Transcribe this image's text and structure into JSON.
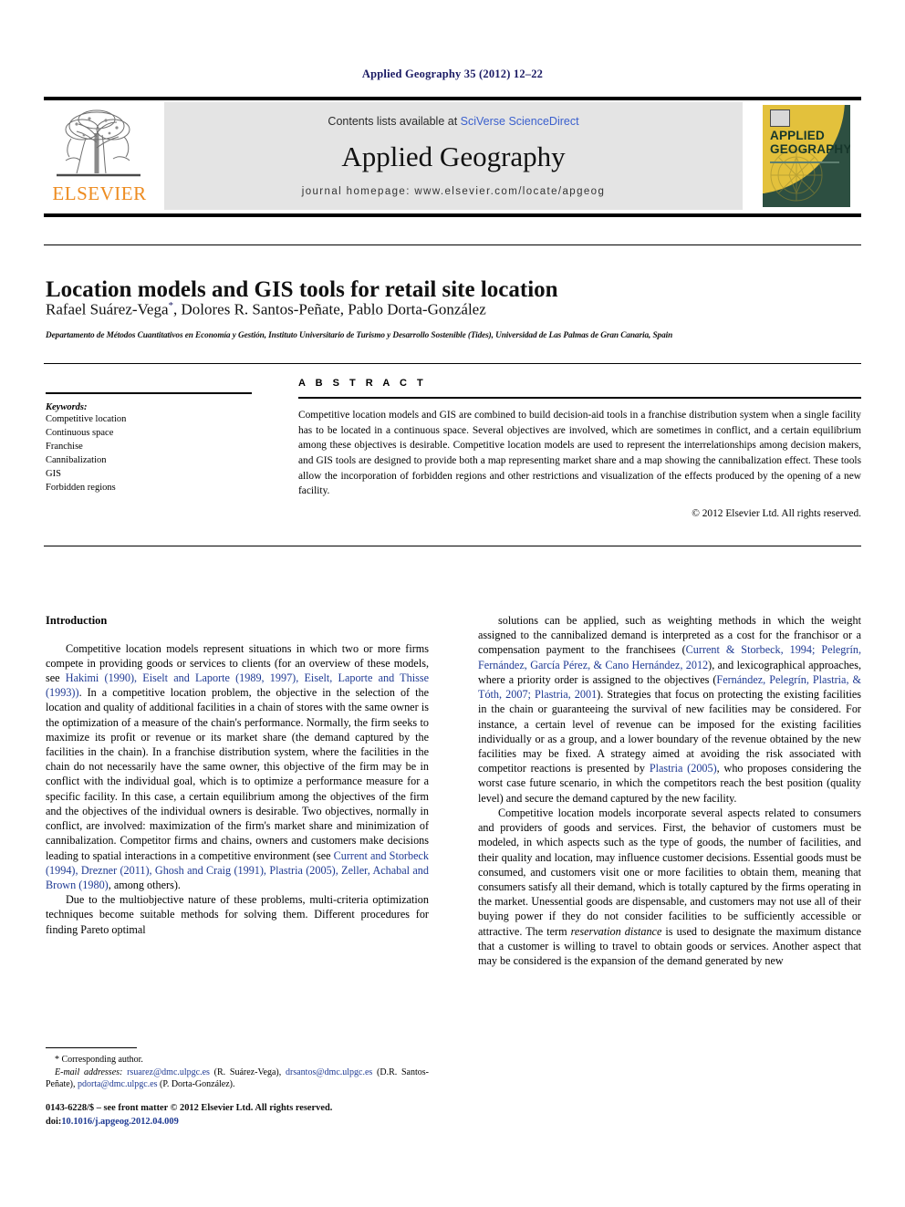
{
  "running_head": "Applied Geography 35 (2012) 12–22",
  "masthead": {
    "contents_prefix": "Contents lists available at ",
    "sciencedirect": "SciVerse ScienceDirect",
    "journal_title": "Applied Geography",
    "homepage": "journal homepage: www.elsevier.com/locate/apgeog",
    "publisher_wordmark": "ELSEVIER",
    "cover_line1": "APPLIED",
    "cover_line2": "GEOGRAPHY",
    "link_color": "#3a5fcd"
  },
  "article": {
    "title": "Location models and GIS tools for retail site location",
    "authors_part1": "Rafael Suárez-Vega",
    "authors_star": "*",
    "authors_part2": ", Dolores R. Santos-Peñate, Pablo Dorta-González",
    "affiliation": "Departamento de Métodos Cuantitativos en Economía y Gestión, Instituto Universitario de Turismo y Desarrollo Sostenible (Tides), Universidad de Las Palmas de Gran Canaria, Spain"
  },
  "keywords": {
    "heading": "Keywords:",
    "items": [
      "Competitive location",
      "Continuous space",
      "Franchise",
      "Cannibalization",
      "GIS",
      "Forbidden regions"
    ]
  },
  "abstract": {
    "heading": "A B S T R A C T",
    "text": "Competitive location models and GIS are combined to build decision-aid tools in a franchise distribution system when a single facility has to be located in a continuous space. Several objectives are involved, which are sometimes in conflict, and a certain equilibrium among these objectives is desirable. Competitive location models are used to represent the interrelationships among decision makers, and GIS tools are designed to provide both a map representing market share and a map showing the cannibalization effect. These tools allow the incorporation of forbidden regions and other restrictions and visualization of the effects produced by the opening of a new facility.",
    "copyright": "© 2012 Elsevier Ltd. All rights reserved."
  },
  "body": {
    "section_heading": "Introduction",
    "left_p1_a": "Competitive location models represent situations in which two or more firms compete in providing goods or services to clients (for an overview of these models, see ",
    "left_p1_refs1": "Hakimi (1990), Eiselt and Laporte (1989, 1997), Eiselt, Laporte and Thisse (1993))",
    "left_p1_b": ". In a competitive location problem, the objective in the selection of the location and quality of additional facilities in a chain of stores with the same owner is the optimization of a measure of the chain's performance. Normally, the firm seeks to maximize its profit or revenue or its market share (the demand captured by the facilities in the chain). In a franchise distribution system, where the facilities in the chain do not necessarily have the same owner, this objective of the firm may be in conflict with the individual goal, which is to optimize a performance measure for a specific facility. In this case, a certain equilibrium among the objectives of the firm and the objectives of the individual owners is desirable. Two objectives, normally in conflict, are involved: maximization of the firm's market share and minimization of cannibalization. Competitor firms and chains, owners and customers make decisions leading to spatial interactions in a competitive environment (see ",
    "left_p1_refs2": "Current and Storbeck (1994), Drezner (2011), Ghosh and Craig (1991), Plastria (2005), Zeller, Achabal and Brown (1980)",
    "left_p1_c": ", among others).",
    "left_p2": "Due to the multiobjective nature of these problems, multi-criteria optimization techniques become suitable methods for solving them. Different procedures for finding Pareto optimal",
    "right_p1_a": "solutions can be applied, such as weighting methods in which the weight assigned to the cannibalized demand is interpreted as a cost for the franchisor or a compensation payment to the franchisees (",
    "right_p1_refs1": "Current & Storbeck, 1994; Pelegrín, Fernández, García Pérez, & Cano Hernández, 2012",
    "right_p1_b": "), and lexicographical approaches, where a priority order is assigned to the objectives (",
    "right_p1_refs2": "Fernández, Pelegrín, Plastria, & Tóth, 2007; Plastria, 2001",
    "right_p1_c": "). Strategies that focus on protecting the existing facilities in the chain or guaranteeing the survival of new facilities may be considered. For instance, a certain level of revenue can be imposed for the existing facilities individually or as a group, and a lower boundary of the revenue obtained by the new facilities may be fixed. A strategy aimed at avoiding the risk associated with competitor reactions is presented by ",
    "right_p1_refs3": "Plastria (2005)",
    "right_p1_d": ", who proposes considering the worst case future scenario, in which the competitors reach the best position (quality level) and secure the demand captured by the new facility.",
    "right_p2_a": "Competitive location models incorporate several aspects related to consumers and providers of goods and services. First, the behavior of customers must be modeled, in which aspects such as the type of goods, the number of facilities, and their quality and location, may influence customer decisions. Essential goods must be consumed, and customers visit one or more facilities to obtain them, meaning that consumers satisfy all their demand, which is totally captured by the firms operating in the market. Unessential goods are dispensable, and customers may not use all of their buying power if they do not consider facilities to be sufficiently accessible or attractive. The term ",
    "right_p2_em": "reservation distance",
    "right_p2_b": " is used to designate the maximum distance that a customer is willing to travel to obtain goods or services. Another aspect that may be considered is the expansion of the demand generated by new"
  },
  "footnote": {
    "corresponding": "* Corresponding author.",
    "email_label": "E-mail addresses:",
    "email1": "rsuarez@dmc.ulpgc.es",
    "name1": "(R. Suárez-Vega)",
    "email2": "drsantos@dmc.ulpgc.es",
    "name2": "(D.R. Santos-Peñate)",
    "email3": "pdorta@dmc.ulpgc.es",
    "name3": "(P. Dorta-González)"
  },
  "imprint": {
    "issn_line": "0143-6228/$ – see front matter © 2012 Elsevier Ltd. All rights reserved.",
    "doi_label": "doi:",
    "doi_value": "10.1016/j.apgeog.2012.04.009"
  }
}
